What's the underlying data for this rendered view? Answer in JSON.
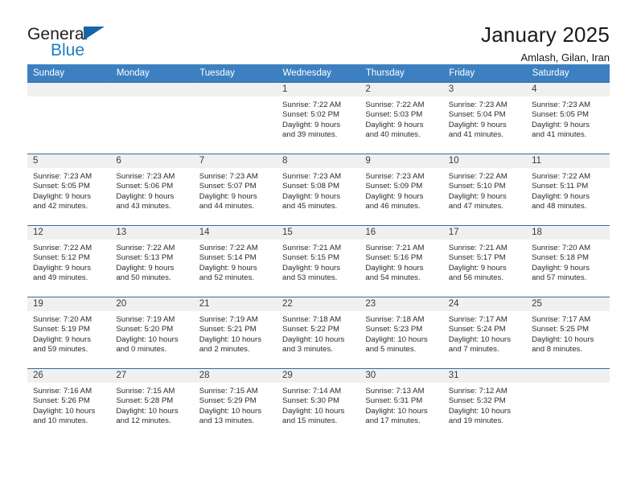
{
  "brand": {
    "line1": "General",
    "line2": "Blue",
    "triangle_color": "#1565a8",
    "blue_text_color": "#1d7cc4"
  },
  "header": {
    "title": "January 2025",
    "subtitle": "Amlash, Gilan, Iran"
  },
  "theme": {
    "header_bg": "#3d80c1",
    "row_divider": "#2e6da4",
    "daynum_band": "#f0f0f0"
  },
  "weekday_headers": [
    "Sunday",
    "Monday",
    "Tuesday",
    "Wednesday",
    "Thursday",
    "Friday",
    "Saturday"
  ],
  "weeks": [
    [
      {
        "day": "",
        "sunrise": "",
        "sunset": "",
        "daylight1": "",
        "daylight2": "",
        "empty": true
      },
      {
        "day": "",
        "sunrise": "",
        "sunset": "",
        "daylight1": "",
        "daylight2": "",
        "empty": true
      },
      {
        "day": "",
        "sunrise": "",
        "sunset": "",
        "daylight1": "",
        "daylight2": "",
        "empty": true
      },
      {
        "day": "1",
        "sunrise": "Sunrise: 7:22 AM",
        "sunset": "Sunset: 5:02 PM",
        "daylight1": "Daylight: 9 hours",
        "daylight2": "and 39 minutes."
      },
      {
        "day": "2",
        "sunrise": "Sunrise: 7:22 AM",
        "sunset": "Sunset: 5:03 PM",
        "daylight1": "Daylight: 9 hours",
        "daylight2": "and 40 minutes."
      },
      {
        "day": "3",
        "sunrise": "Sunrise: 7:23 AM",
        "sunset": "Sunset: 5:04 PM",
        "daylight1": "Daylight: 9 hours",
        "daylight2": "and 41 minutes."
      },
      {
        "day": "4",
        "sunrise": "Sunrise: 7:23 AM",
        "sunset": "Sunset: 5:05 PM",
        "daylight1": "Daylight: 9 hours",
        "daylight2": "and 41 minutes."
      }
    ],
    [
      {
        "day": "5",
        "sunrise": "Sunrise: 7:23 AM",
        "sunset": "Sunset: 5:05 PM",
        "daylight1": "Daylight: 9 hours",
        "daylight2": "and 42 minutes."
      },
      {
        "day": "6",
        "sunrise": "Sunrise: 7:23 AM",
        "sunset": "Sunset: 5:06 PM",
        "daylight1": "Daylight: 9 hours",
        "daylight2": "and 43 minutes."
      },
      {
        "day": "7",
        "sunrise": "Sunrise: 7:23 AM",
        "sunset": "Sunset: 5:07 PM",
        "daylight1": "Daylight: 9 hours",
        "daylight2": "and 44 minutes."
      },
      {
        "day": "8",
        "sunrise": "Sunrise: 7:23 AM",
        "sunset": "Sunset: 5:08 PM",
        "daylight1": "Daylight: 9 hours",
        "daylight2": "and 45 minutes."
      },
      {
        "day": "9",
        "sunrise": "Sunrise: 7:23 AM",
        "sunset": "Sunset: 5:09 PM",
        "daylight1": "Daylight: 9 hours",
        "daylight2": "and 46 minutes."
      },
      {
        "day": "10",
        "sunrise": "Sunrise: 7:22 AM",
        "sunset": "Sunset: 5:10 PM",
        "daylight1": "Daylight: 9 hours",
        "daylight2": "and 47 minutes."
      },
      {
        "day": "11",
        "sunrise": "Sunrise: 7:22 AM",
        "sunset": "Sunset: 5:11 PM",
        "daylight1": "Daylight: 9 hours",
        "daylight2": "and 48 minutes."
      }
    ],
    [
      {
        "day": "12",
        "sunrise": "Sunrise: 7:22 AM",
        "sunset": "Sunset: 5:12 PM",
        "daylight1": "Daylight: 9 hours",
        "daylight2": "and 49 minutes."
      },
      {
        "day": "13",
        "sunrise": "Sunrise: 7:22 AM",
        "sunset": "Sunset: 5:13 PM",
        "daylight1": "Daylight: 9 hours",
        "daylight2": "and 50 minutes."
      },
      {
        "day": "14",
        "sunrise": "Sunrise: 7:22 AM",
        "sunset": "Sunset: 5:14 PM",
        "daylight1": "Daylight: 9 hours",
        "daylight2": "and 52 minutes."
      },
      {
        "day": "15",
        "sunrise": "Sunrise: 7:21 AM",
        "sunset": "Sunset: 5:15 PM",
        "daylight1": "Daylight: 9 hours",
        "daylight2": "and 53 minutes."
      },
      {
        "day": "16",
        "sunrise": "Sunrise: 7:21 AM",
        "sunset": "Sunset: 5:16 PM",
        "daylight1": "Daylight: 9 hours",
        "daylight2": "and 54 minutes."
      },
      {
        "day": "17",
        "sunrise": "Sunrise: 7:21 AM",
        "sunset": "Sunset: 5:17 PM",
        "daylight1": "Daylight: 9 hours",
        "daylight2": "and 56 minutes."
      },
      {
        "day": "18",
        "sunrise": "Sunrise: 7:20 AM",
        "sunset": "Sunset: 5:18 PM",
        "daylight1": "Daylight: 9 hours",
        "daylight2": "and 57 minutes."
      }
    ],
    [
      {
        "day": "19",
        "sunrise": "Sunrise: 7:20 AM",
        "sunset": "Sunset: 5:19 PM",
        "daylight1": "Daylight: 9 hours",
        "daylight2": "and 59 minutes."
      },
      {
        "day": "20",
        "sunrise": "Sunrise: 7:19 AM",
        "sunset": "Sunset: 5:20 PM",
        "daylight1": "Daylight: 10 hours",
        "daylight2": "and 0 minutes."
      },
      {
        "day": "21",
        "sunrise": "Sunrise: 7:19 AM",
        "sunset": "Sunset: 5:21 PM",
        "daylight1": "Daylight: 10 hours",
        "daylight2": "and 2 minutes."
      },
      {
        "day": "22",
        "sunrise": "Sunrise: 7:18 AM",
        "sunset": "Sunset: 5:22 PM",
        "daylight1": "Daylight: 10 hours",
        "daylight2": "and 3 minutes."
      },
      {
        "day": "23",
        "sunrise": "Sunrise: 7:18 AM",
        "sunset": "Sunset: 5:23 PM",
        "daylight1": "Daylight: 10 hours",
        "daylight2": "and 5 minutes."
      },
      {
        "day": "24",
        "sunrise": "Sunrise: 7:17 AM",
        "sunset": "Sunset: 5:24 PM",
        "daylight1": "Daylight: 10 hours",
        "daylight2": "and 7 minutes."
      },
      {
        "day": "25",
        "sunrise": "Sunrise: 7:17 AM",
        "sunset": "Sunset: 5:25 PM",
        "daylight1": "Daylight: 10 hours",
        "daylight2": "and 8 minutes."
      }
    ],
    [
      {
        "day": "26",
        "sunrise": "Sunrise: 7:16 AM",
        "sunset": "Sunset: 5:26 PM",
        "daylight1": "Daylight: 10 hours",
        "daylight2": "and 10 minutes."
      },
      {
        "day": "27",
        "sunrise": "Sunrise: 7:15 AM",
        "sunset": "Sunset: 5:28 PM",
        "daylight1": "Daylight: 10 hours",
        "daylight2": "and 12 minutes."
      },
      {
        "day": "28",
        "sunrise": "Sunrise: 7:15 AM",
        "sunset": "Sunset: 5:29 PM",
        "daylight1": "Daylight: 10 hours",
        "daylight2": "and 13 minutes."
      },
      {
        "day": "29",
        "sunrise": "Sunrise: 7:14 AM",
        "sunset": "Sunset: 5:30 PM",
        "daylight1": "Daylight: 10 hours",
        "daylight2": "and 15 minutes."
      },
      {
        "day": "30",
        "sunrise": "Sunrise: 7:13 AM",
        "sunset": "Sunset: 5:31 PM",
        "daylight1": "Daylight: 10 hours",
        "daylight2": "and 17 minutes."
      },
      {
        "day": "31",
        "sunrise": "Sunrise: 7:12 AM",
        "sunset": "Sunset: 5:32 PM",
        "daylight1": "Daylight: 10 hours",
        "daylight2": "and 19 minutes."
      },
      {
        "day": "",
        "sunrise": "",
        "sunset": "",
        "daylight1": "",
        "daylight2": "",
        "empty": true
      }
    ]
  ]
}
